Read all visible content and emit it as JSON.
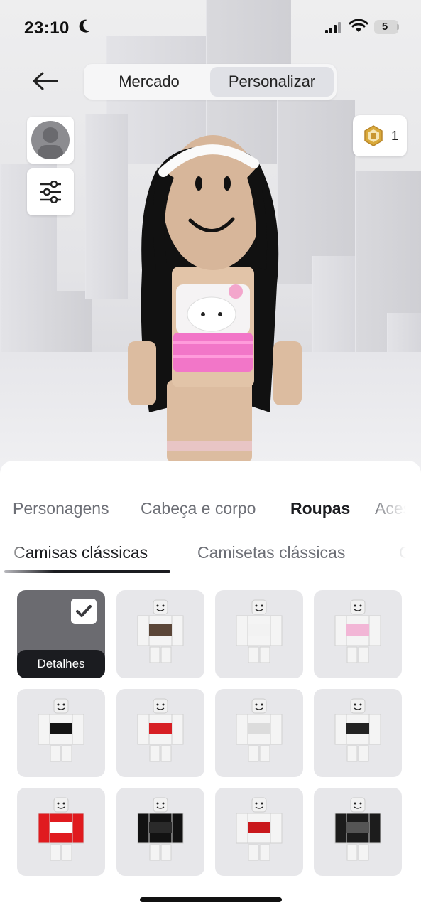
{
  "status_bar": {
    "time": "23:10",
    "battery": "5"
  },
  "top_nav": {
    "mercado": "Mercado",
    "personalizar": "Personalizar",
    "active": "Personalizar"
  },
  "robux": {
    "count": "1"
  },
  "category_tabs": [
    {
      "label": "Personagens",
      "active": false
    },
    {
      "label": "Cabeça e corpo",
      "active": false
    },
    {
      "label": "Roupas",
      "active": true
    },
    {
      "label": "Aces",
      "active": false
    }
  ],
  "sub_tabs": [
    {
      "label": "Camisas clássicas",
      "active": true
    },
    {
      "label": "Camisetas clássicas",
      "active": false
    },
    {
      "label": "Ca",
      "active": false
    }
  ],
  "grid": {
    "details_label": "Detalhes",
    "items": [
      {
        "shirt": "#e9e9eb",
        "print": "",
        "equipped": true
      },
      {
        "shirt": "#f4f4f4",
        "print": "#5b4638",
        "equipped": false
      },
      {
        "shirt": "#f4f4f4",
        "print": "#f2f2f2",
        "equipped": false
      },
      {
        "shirt": "#f4f4f4",
        "print": "#f2b6d6",
        "equipped": false
      },
      {
        "shirt": "#f4f4f4",
        "print": "#141414",
        "equipped": false
      },
      {
        "shirt": "#f4f4f4",
        "print": "#d71f24",
        "equipped": false
      },
      {
        "shirt": "#f4f4f4",
        "print": "#dcdcdc",
        "equipped": false
      },
      {
        "shirt": "#f4f4f4",
        "print": "#222222",
        "equipped": false
      },
      {
        "shirt": "#e01b1f",
        "print": "#ffffff",
        "equipped": false
      },
      {
        "shirt": "#121212",
        "print": "#2a2a2a",
        "equipped": false
      },
      {
        "shirt": "#f4f4f4",
        "print": "#c9181c",
        "equipped": false
      },
      {
        "shirt": "#1c1c1c",
        "print": "#555555",
        "equipped": false
      }
    ]
  }
}
